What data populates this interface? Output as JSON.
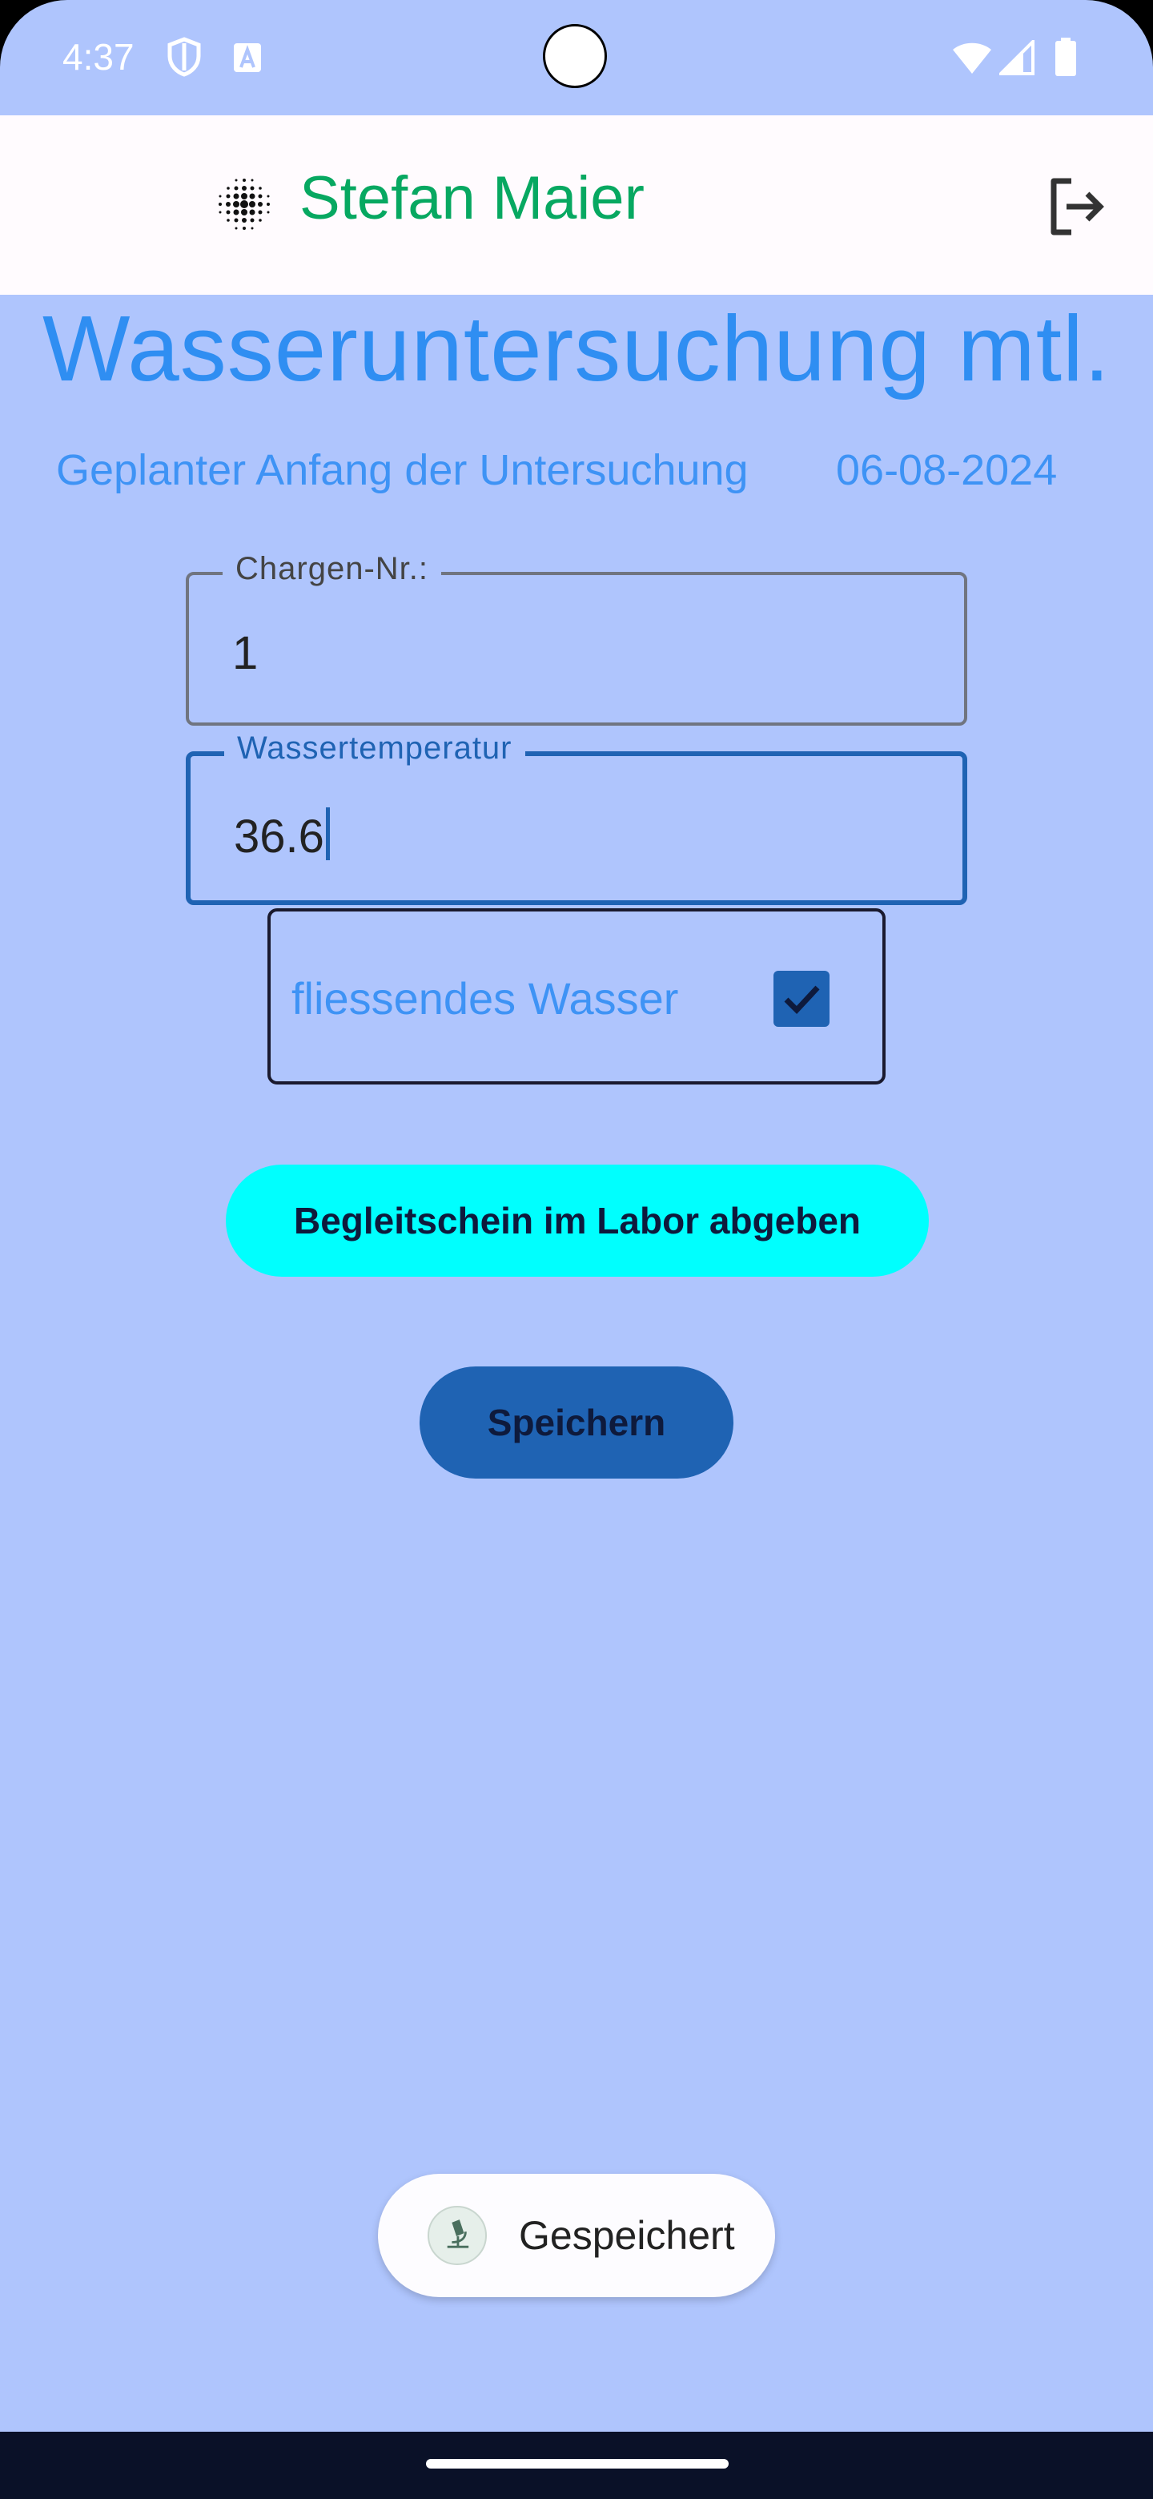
{
  "status_bar": {
    "time": "4:37",
    "icons": [
      "shield-icon",
      "font-a-icon",
      "wifi-icon",
      "signal-icon",
      "battery-icon"
    ]
  },
  "app_bar": {
    "user_name": "Stefan Maier",
    "logo_icon": "dot-grid-logo-icon",
    "logout_icon": "logout-icon",
    "title_color": "#07a861"
  },
  "page": {
    "title": "Wasseruntersuchung mtl.",
    "planned_start_label": "Geplanter Anfang der Untersuchung",
    "planned_start_date": "06-08-2024"
  },
  "form": {
    "batch_label": "Chargen-Nr.:",
    "batch_value": "1",
    "temperature_label": "Wassertemperatur",
    "temperature_value": "36.6",
    "flowing_water_label": "fliessendes Wasser",
    "flowing_water_checked": true
  },
  "buttons": {
    "labor_label": "Begleitschein im Labor abgeben",
    "save_label": "Speichern"
  },
  "toast": {
    "message": "Gespeichert"
  },
  "colors": {
    "background": "#afc5fd",
    "accent": "#1f63b3",
    "labor_button": "#00fffe",
    "title_blue": "#2f8ef2"
  }
}
